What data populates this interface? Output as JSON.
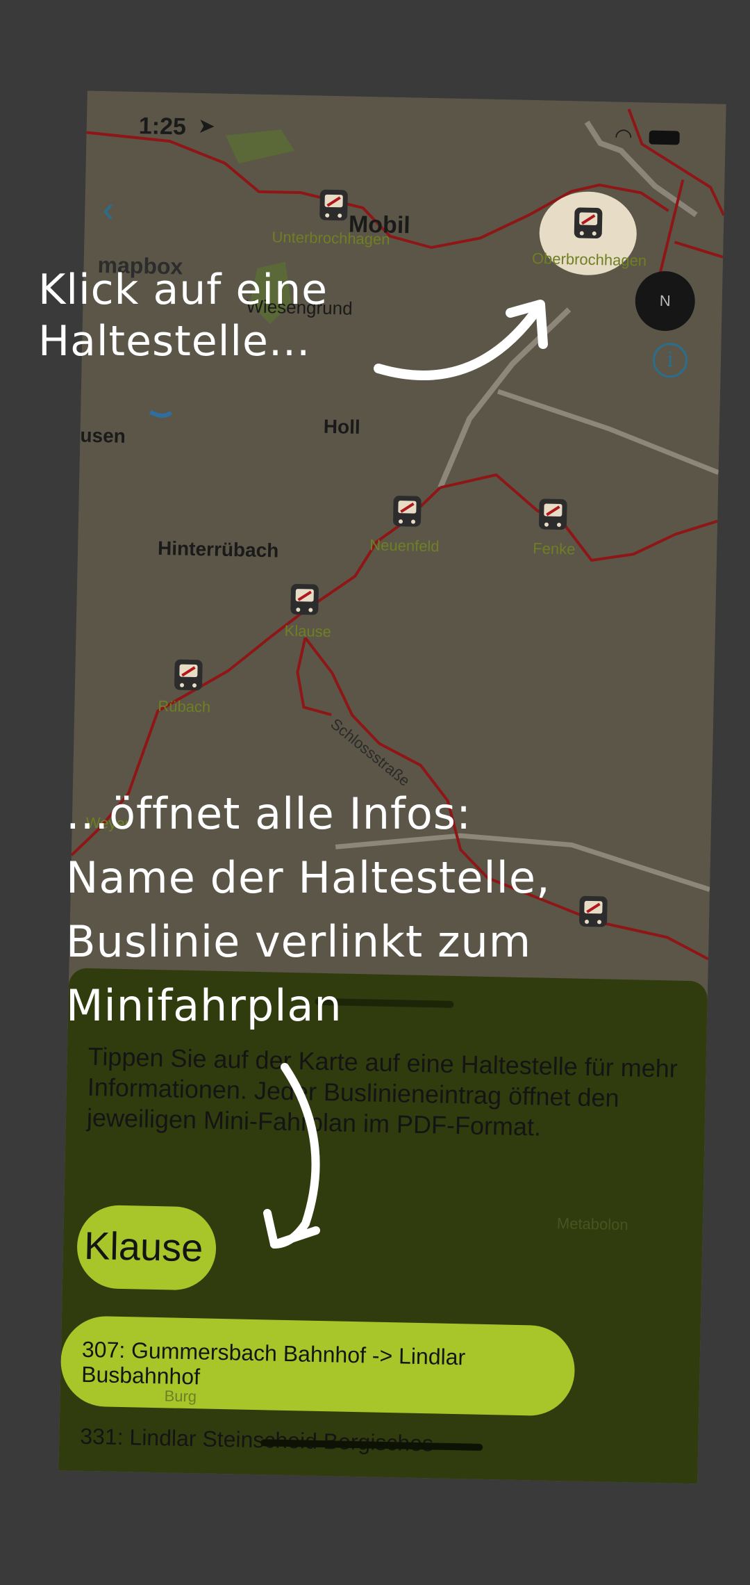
{
  "status_bar": {
    "time": "1:25"
  },
  "header": {
    "back_icon": "chevron-left-icon",
    "title": "Mobil"
  },
  "map": {
    "attribution": "mapbox",
    "compass_label": "N",
    "info_icon": "i",
    "places": [
      {
        "name": "Wiesengrund"
      },
      {
        "name": "Holl"
      },
      {
        "name": "usen"
      },
      {
        "name": "Hinterrübach"
      }
    ],
    "stops": [
      {
        "name": "Unterbrochhagen"
      },
      {
        "name": "Oberbrochhagen"
      },
      {
        "name": "Neuenfeld"
      },
      {
        "name": "Fenke"
      },
      {
        "name": "Klause"
      },
      {
        "name": "Rübach"
      },
      {
        "name": "Weyer"
      }
    ],
    "street": "Schlossstraße",
    "bottom_label": "Burg",
    "poi": "Metabolon"
  },
  "sheet": {
    "hint": "Tippen Sie auf der Karte auf eine Haltestelle für mehr Informationen. Jeder Buslinieneintrag öffnet den jeweiligen Mini-Fahrplan im PDF-Format.",
    "stop_name": "Klause",
    "routes": [
      {
        "label": "307: Gummersbach Bahnhof -> Lindlar Busbahnhof"
      },
      {
        "label": "331: Lindlar Steinscheid Bergisches"
      }
    ]
  },
  "annotations": {
    "top": "Klick auf eine\nHaltestelle...",
    "bottom": "...öffnet alle Infos:\nName der Haltestelle,\nBuslinie verlinkt zum\nMinifahrplan"
  },
  "colors": {
    "route_line": "#9a1010",
    "highlight": "#a8c62a",
    "background": "#3a3a3a"
  }
}
